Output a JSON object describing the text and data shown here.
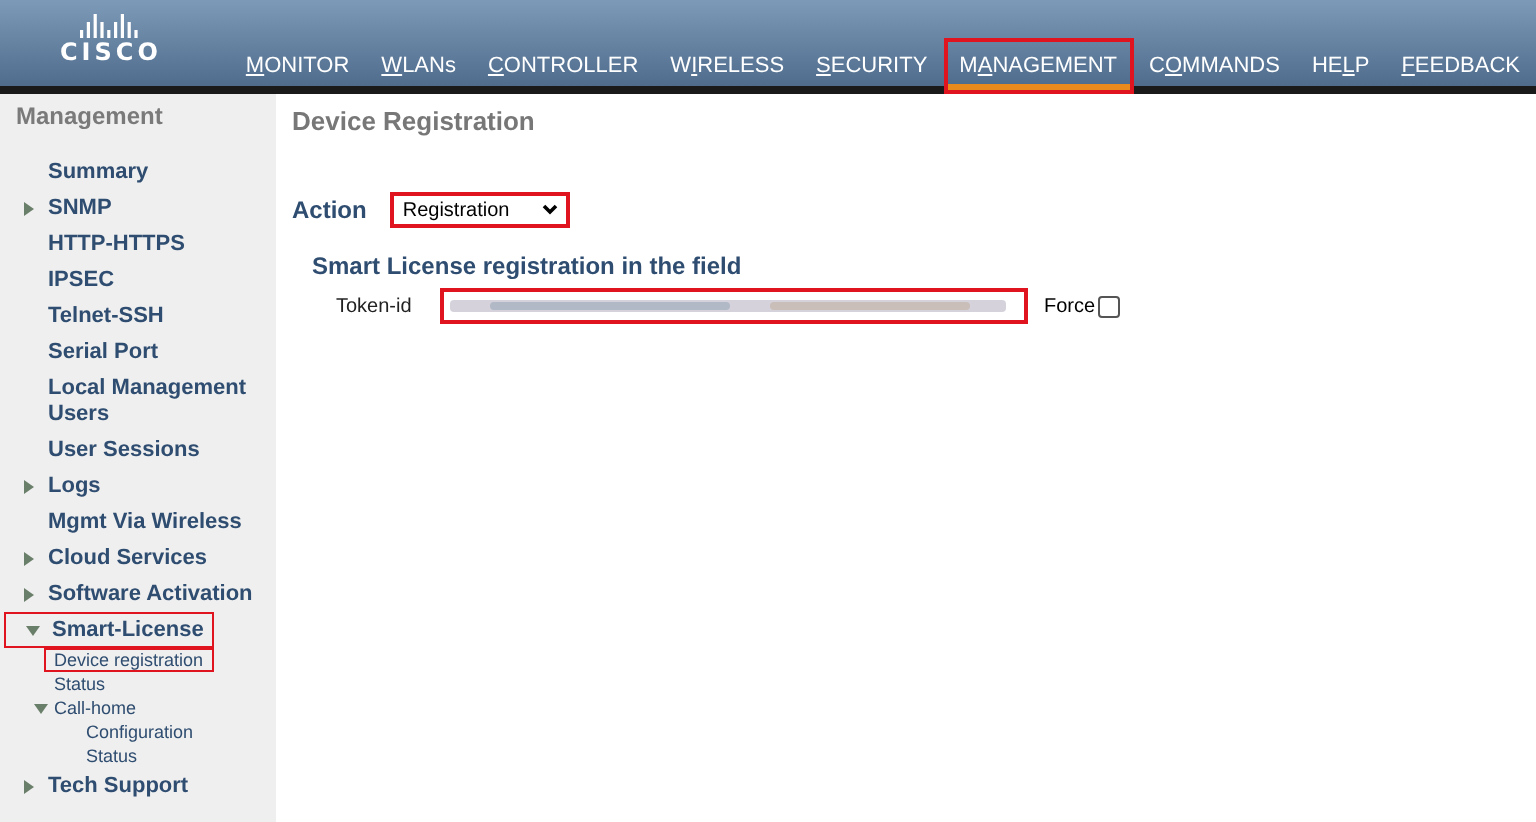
{
  "header": {
    "logo": "CISCO",
    "nav": [
      {
        "hotkey": "M",
        "post": "ONITOR",
        "selected": false,
        "highlighted": false
      },
      {
        "hotkey": "W",
        "post": "LANs",
        "selected": false,
        "highlighted": false
      },
      {
        "hotkey": "C",
        "post": "ONTROLLER",
        "selected": false,
        "highlighted": false
      },
      {
        "pre": "W",
        "hotkey": "I",
        "post": "RELESS",
        "selected": false,
        "highlighted": false
      },
      {
        "hotkey": "S",
        "post": "ECURITY",
        "selected": false,
        "highlighted": false
      },
      {
        "pre": "M",
        "hotkey": "A",
        "post": "NAGEMENT",
        "selected": true,
        "highlighted": true
      },
      {
        "pre": "C",
        "hotkey": "O",
        "post": "MMANDS",
        "selected": false,
        "highlighted": false
      },
      {
        "pre": "HE",
        "hotkey": "L",
        "post": "P",
        "selected": false,
        "highlighted": false
      },
      {
        "hotkey": "F",
        "post": "EEDBACK",
        "selected": false,
        "highlighted": false
      }
    ]
  },
  "sidebar": {
    "title": "Management",
    "items": [
      {
        "label": "Summary",
        "expandable": false,
        "highlighted": false
      },
      {
        "label": "SNMP",
        "expandable": true,
        "expanded": false,
        "highlighted": false
      },
      {
        "label": "HTTP-HTTPS",
        "expandable": false,
        "highlighted": false
      },
      {
        "label": "IPSEC",
        "expandable": false,
        "highlighted": false
      },
      {
        "label": "Telnet-SSH",
        "expandable": false,
        "highlighted": false
      },
      {
        "label": "Serial Port",
        "expandable": false,
        "highlighted": false
      },
      {
        "label": "Local Management Users",
        "expandable": false,
        "highlighted": false
      },
      {
        "label": "User Sessions",
        "expandable": false,
        "highlighted": false
      },
      {
        "label": "Logs",
        "expandable": true,
        "expanded": false,
        "highlighted": false
      },
      {
        "label": "Mgmt Via Wireless",
        "expandable": false,
        "highlighted": false
      },
      {
        "label": "Cloud Services",
        "expandable": true,
        "expanded": false,
        "highlighted": false
      },
      {
        "label": "Software Activation",
        "expandable": true,
        "expanded": false,
        "highlighted": false
      },
      {
        "label": "Smart-License",
        "expandable": true,
        "expanded": true,
        "highlighted": true,
        "children": [
          {
            "label": "Device registration",
            "highlighted": true
          },
          {
            "label": "Status",
            "highlighted": false
          },
          {
            "label": "Call-home",
            "expanded": true,
            "highlighted": false,
            "children": [
              {
                "label": "Configuration",
                "highlighted": false
              },
              {
                "label": "Status",
                "highlighted": false
              }
            ]
          }
        ]
      },
      {
        "label": "Tech Support",
        "expandable": true,
        "expanded": false,
        "highlighted": false
      }
    ]
  },
  "main": {
    "title": "Device Registration",
    "action": {
      "label": "Action",
      "value": "Registration",
      "highlighted": true
    },
    "section_title": "Smart License registration in the field",
    "token": {
      "label": "Token-id",
      "highlighted": true
    },
    "force": {
      "label": "Force",
      "checked": false
    }
  }
}
